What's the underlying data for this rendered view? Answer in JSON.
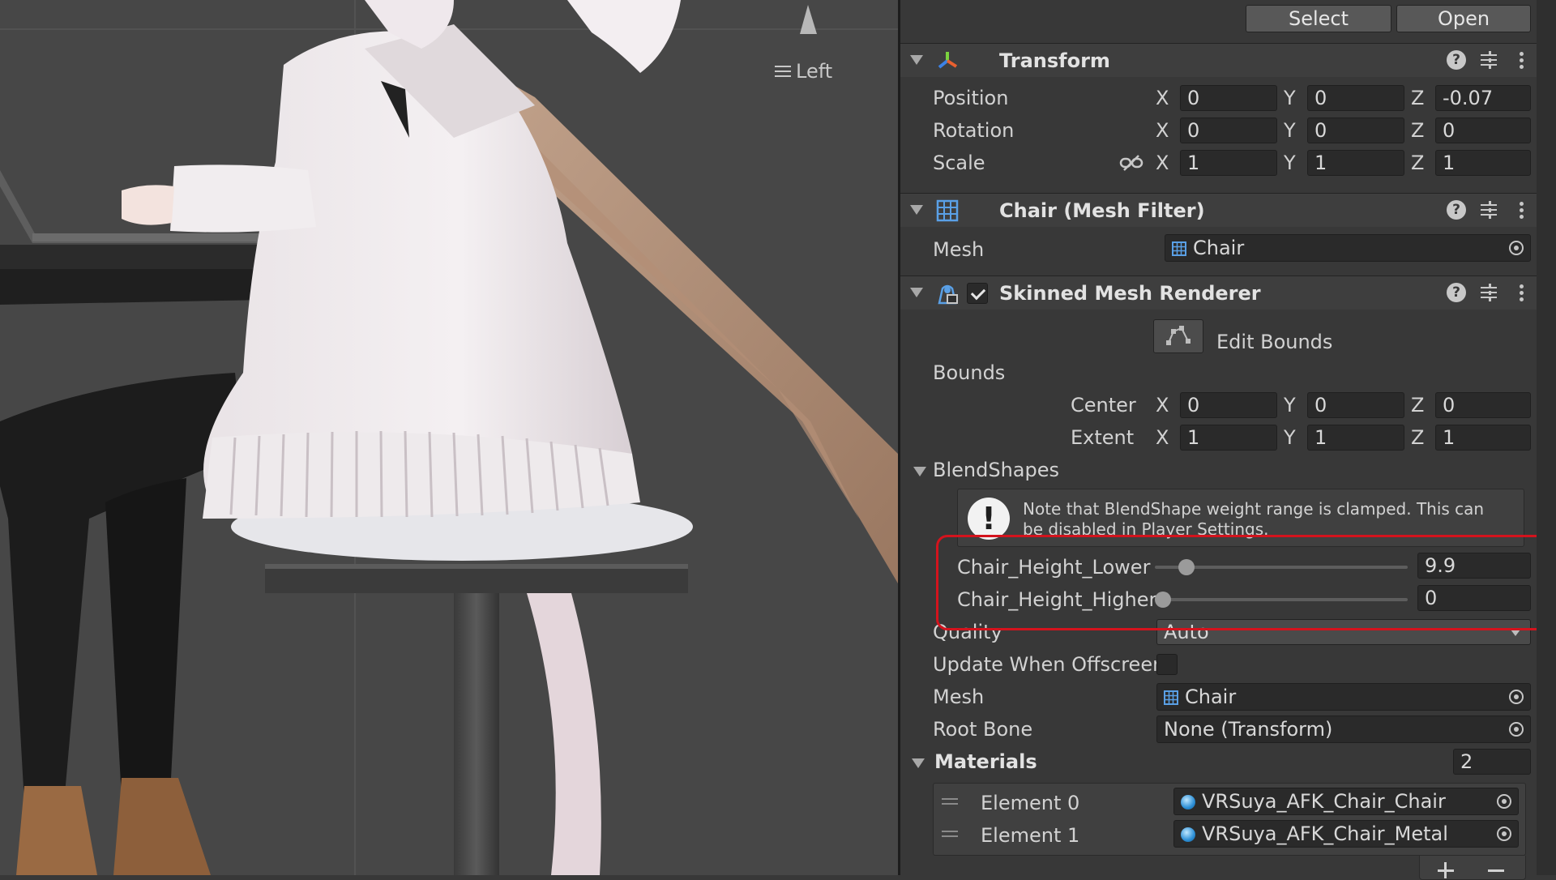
{
  "scene": {
    "view_label": "Left"
  },
  "inspector": {
    "top_buttons": {
      "select": "Select",
      "open": "Open"
    },
    "transform": {
      "title": "Transform",
      "position": {
        "label": "Position",
        "x": "0",
        "y": "0",
        "z": "-0.07"
      },
      "rotation": {
        "label": "Rotation",
        "x": "0",
        "y": "0",
        "z": "0"
      },
      "scale": {
        "label": "Scale",
        "x": "1",
        "y": "1",
        "z": "1"
      },
      "axes": {
        "x": "X",
        "y": "Y",
        "z": "Z"
      }
    },
    "mesh_filter": {
      "title": "Chair (Mesh Filter)",
      "mesh_label": "Mesh",
      "mesh_value": "Chair"
    },
    "skinned_mesh_renderer": {
      "title": "Skinned Mesh Renderer",
      "enabled": true,
      "edit_bounds_label": "Edit Bounds",
      "bounds": {
        "label": "Bounds",
        "center": {
          "label": "Center",
          "x": "0",
          "y": "0",
          "z": "0"
        },
        "extent": {
          "label": "Extent",
          "x": "1",
          "y": "1",
          "z": "1"
        }
      },
      "blendshapes": {
        "label": "BlendShapes",
        "note": "Note that BlendShape weight range is clamped. This can be disabled in Player Settings.",
        "items": [
          {
            "name": "Chair_Height_Lower",
            "value": "9.9",
            "weight": 9.9
          },
          {
            "name": "Chair_Height_Higher",
            "value": "0",
            "weight": 0
          }
        ]
      },
      "quality": {
        "label": "Quality",
        "value": "Auto"
      },
      "update_when_offscreen": {
        "label": "Update When Offscreen",
        "checked": false
      },
      "mesh": {
        "label": "Mesh",
        "value": "Chair"
      },
      "root_bone": {
        "label": "Root Bone",
        "value": "None (Transform)"
      },
      "materials": {
        "label": "Materials",
        "count": "2",
        "elements": [
          {
            "label": "Element 0",
            "value": "VRSuya_AFK_Chair_Chair"
          },
          {
            "label": "Element 1",
            "value": "VRSuya_AFK_Chair_Metal"
          }
        ]
      }
    }
  },
  "colors": {
    "highlight": "#d4131d",
    "panel_bg": "#383838",
    "scene_bg": "#474747"
  }
}
